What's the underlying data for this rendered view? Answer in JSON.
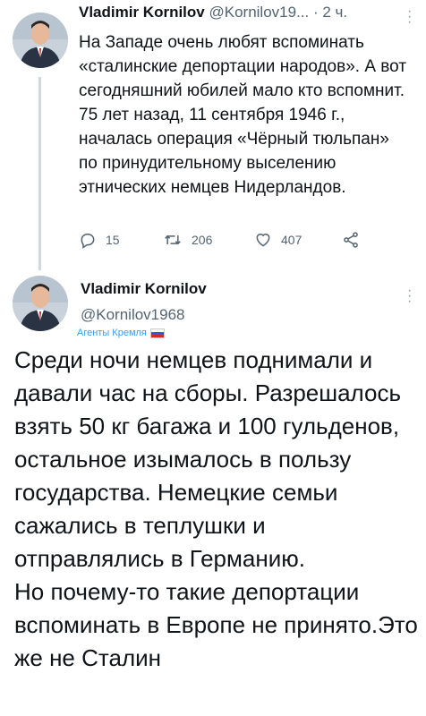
{
  "tweet1": {
    "author_name": "Vladimir Kornilov",
    "author_handle": "@Kornilov19...",
    "time": "· 2 ч.",
    "text": "На Западе очень любят вспоминать «сталинские депортации народов». А вот сегодняшний юбилей мало кто вспомнит. 75 лет назад, 11 сентября 1946 г., началась операция «Чёрный тюльпан» по принудительному выселению этнических немцев Нидерландов.",
    "replies": "15",
    "retweets": "206",
    "likes": "407"
  },
  "tweet2": {
    "author_name": "Vladimir Kornilov",
    "author_handle": "@Kornilov1968",
    "badge": "Агенты Кремля",
    "text_line1": "Среди ночи немцев поднимали и давали час на сборы. Разрешалось взять 50 кг багажа и 100 гульденов, остальное изымалось в пользу государства. Немецкие семьи сажались в теплушки и отправлялись в Германию.",
    "text_line2": "Но почему-то такие депортации вспоминать в Европе не принято.Это же не Сталин"
  },
  "icons": {
    "reply": "reply-icon",
    "retweet": "retweet-icon",
    "like": "heart-icon",
    "share": "share-icon",
    "more": "more-vertical-icon",
    "flag": "russia-flag-icon"
  },
  "colors": {
    "text": "#0f1419",
    "secondary": "#536471",
    "badge": "#3d9be9",
    "thread_line": "#cfd9de"
  }
}
